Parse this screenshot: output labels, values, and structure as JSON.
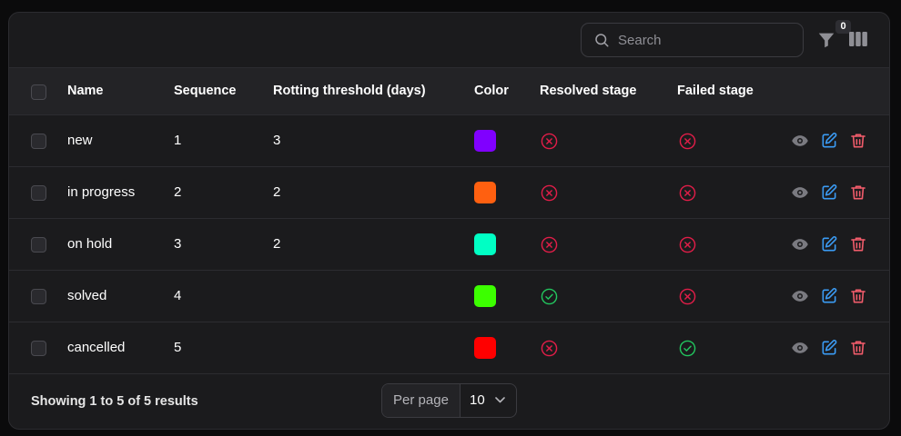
{
  "search": {
    "placeholder": "Search"
  },
  "filter": {
    "badge_count": "0"
  },
  "table": {
    "headers": {
      "name": "Name",
      "sequence": "Sequence",
      "rotting": "Rotting threshold (days)",
      "color": "Color",
      "resolved": "Resolved stage",
      "failed": "Failed stage"
    },
    "rows": [
      {
        "name": "new",
        "sequence": "1",
        "rotting": "3",
        "color": "#8000ff",
        "resolved": false,
        "failed": false
      },
      {
        "name": "in progress",
        "sequence": "2",
        "rotting": "2",
        "color": "#ff6010",
        "resolved": false,
        "failed": false
      },
      {
        "name": "on hold",
        "sequence": "3",
        "rotting": "2",
        "color": "#00ffc4",
        "resolved": false,
        "failed": false
      },
      {
        "name": "solved",
        "sequence": "4",
        "rotting": "",
        "color": "#3cff00",
        "resolved": true,
        "failed": false
      },
      {
        "name": "cancelled",
        "sequence": "5",
        "rotting": "",
        "color": "#ff0000",
        "resolved": false,
        "failed": true
      }
    ]
  },
  "footer": {
    "results_text": "Showing 1 to 5 of 5 results",
    "per_page_label": "Per page",
    "per_page_value": "10"
  },
  "icons": {
    "status_true": "check-circle-icon",
    "status_false": "x-circle-icon",
    "view": "eye-icon",
    "edit": "pencil-square-icon",
    "delete": "trash-icon"
  },
  "colors": {
    "status_true": "#22c55e",
    "status_false": "#e11d48",
    "view": "#7a7a80",
    "edit": "#3b9cf5",
    "delete": "#f25c6b"
  }
}
